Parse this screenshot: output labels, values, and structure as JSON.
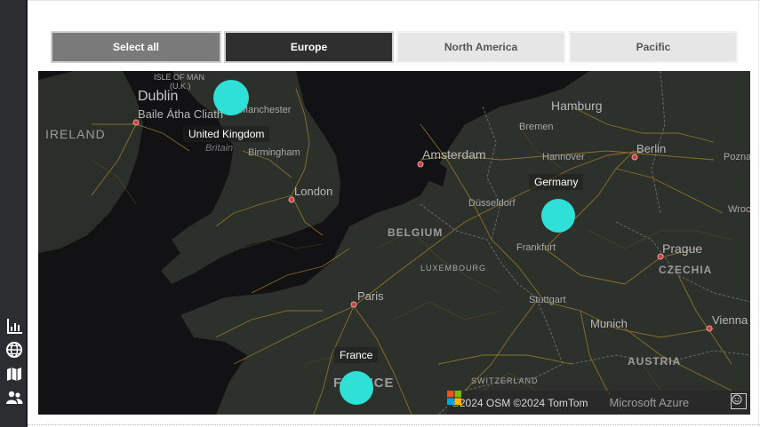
{
  "slicer": {
    "buttons": [
      {
        "label": "Select all"
      },
      {
        "label": "Europe"
      },
      {
        "label": "North America"
      },
      {
        "label": "Pacific"
      }
    ]
  },
  "rail": {
    "icons": [
      "bar-chart-icon",
      "globe-icon",
      "map-icon",
      "people-icon"
    ]
  },
  "map": {
    "place_labels": {
      "dublin": "Dublin",
      "ireland_region": "(U.K.)",
      "isle_of_man": "ISLE OF MAN",
      "baile_atha_cliath": "Baile Átha Cliath",
      "ireland": "IRELAND",
      "manchester": "Manchester",
      "britain": "Britain",
      "birmingham": "Birmingham",
      "london": "London",
      "hamburg": "Hamburg",
      "bremen": "Bremen",
      "hannover": "Hannover",
      "berlin": "Berlin",
      "poznan": "Pozna",
      "amsterdam": "Amsterdam",
      "dusseldorf": "Düsseldorf",
      "wroc": "Wroc",
      "belgium": "BELGIUM",
      "luxembourg": "LUXEMBOURG",
      "frankfurt": "Frankfurt",
      "prague": "Prague",
      "czechia": "CZECHIA",
      "paris": "Paris",
      "stuttgart": "Stuttgart",
      "munich": "Munich",
      "vienna": "Vienna",
      "austria": "AUSTRIA",
      "switzerland": "SWITZERLAND",
      "france_base": "FRANCE"
    },
    "bubbles": [
      {
        "label": "United Kingdom"
      },
      {
        "label": "Germany"
      },
      {
        "label": "France"
      }
    ],
    "attribution": "©2024 OSM ©2024 TomTom",
    "provider": "Microsoft Azure",
    "colors": {
      "bubble": "#2ee0d5",
      "land": "#2a2f2a",
      "water": "#121214",
      "roads": "#a07a2a"
    }
  }
}
